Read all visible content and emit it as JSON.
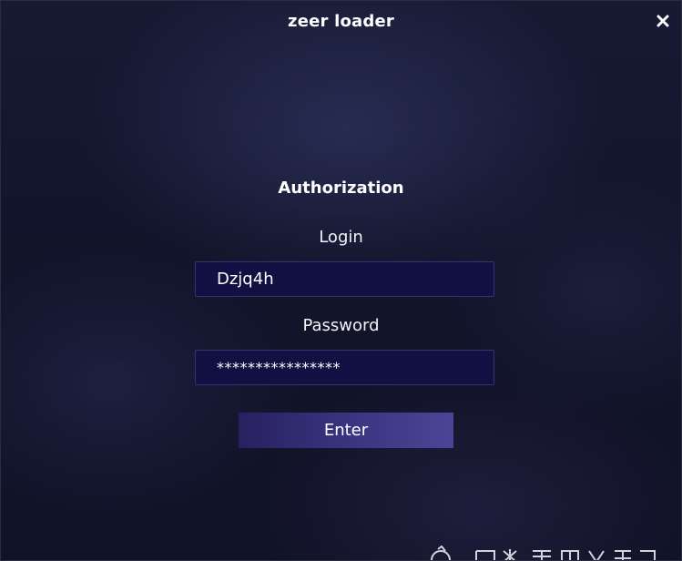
{
  "window": {
    "title": "zeer loader"
  },
  "auth": {
    "heading": "Authorization",
    "login_label": "Login",
    "login_value": "Dzjq4h",
    "password_label": "Password",
    "password_value": "****************",
    "enter_label": "Enter"
  },
  "icons": {
    "close": "close-icon",
    "watermark": "watermark-logo"
  },
  "colors": {
    "background": "#12142a",
    "field_bg": "#121042",
    "field_border": "#33366a",
    "button_start": "#272160",
    "button_end": "#4b4596",
    "text": "#ffffff"
  }
}
